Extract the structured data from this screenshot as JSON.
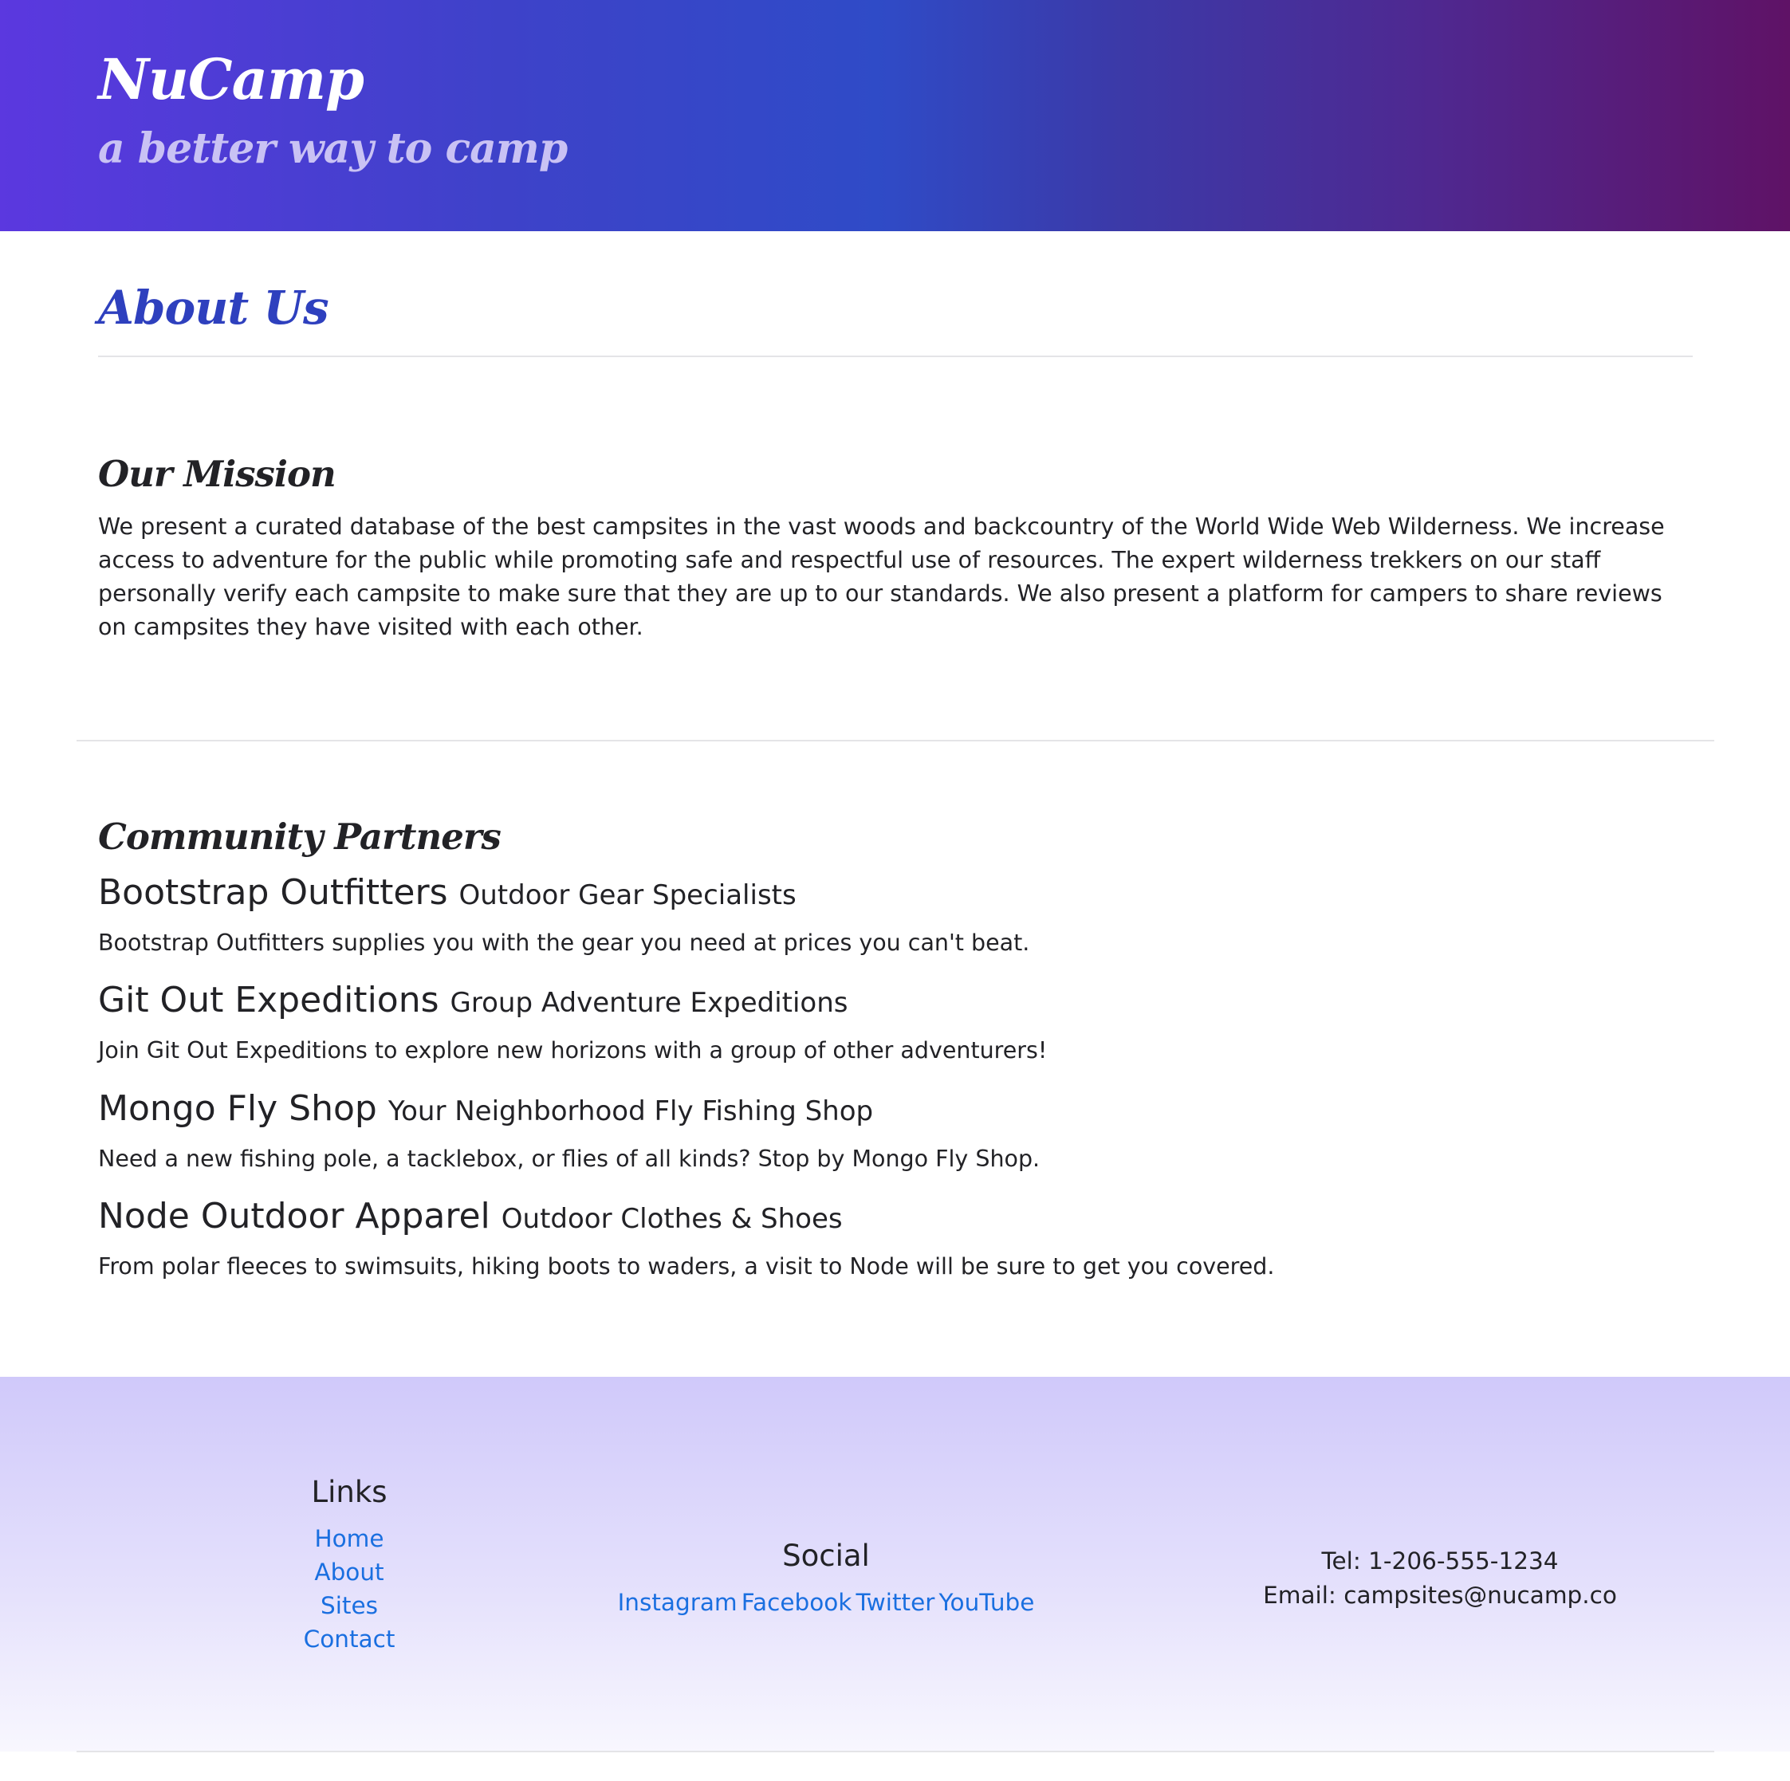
{
  "header": {
    "brand": "NuCamp",
    "tagline": "a better way to camp"
  },
  "main": {
    "title": "About Us",
    "mission": {
      "heading": "Our Mission",
      "text": "We present a curated database of the best campsites in the vast woods and backcountry of the World Wide Web Wilderness. We increase access to adventure for the public while promoting safe and respectful use of resources. The expert wilderness trekkers on our staff personally verify each campsite to make sure that they are up to our standards. We also present a platform for campers to share reviews on campsites they have visited with each other."
    },
    "partners": {
      "heading": "Community Partners",
      "items": [
        {
          "name": "Bootstrap Outfitters",
          "subtitle": "Outdoor Gear Specialists",
          "description": "Bootstrap Outfitters supplies you with the gear you need at prices you can't beat."
        },
        {
          "name": "Git Out Expeditions",
          "subtitle": "Group Adventure Expeditions",
          "description": "Join Git Out Expeditions to explore new horizons with a group of other adventurers!"
        },
        {
          "name": "Mongo Fly Shop",
          "subtitle": "Your Neighborhood Fly Fishing Shop",
          "description": "Need a new fishing pole, a tacklebox, or flies of all kinds? Stop by Mongo Fly Shop."
        },
        {
          "name": "Node Outdoor Apparel",
          "subtitle": "Outdoor Clothes & Shoes",
          "description": "From polar fleeces to swimsuits, hiking boots to waders, a visit to Node will be sure to get you covered."
        }
      ]
    }
  },
  "footer": {
    "links": {
      "heading": "Links",
      "items": [
        "Home",
        "About",
        "Sites",
        "Contact"
      ]
    },
    "social": {
      "heading": "Social",
      "items": [
        "Instagram",
        "Facebook",
        "Twitter",
        "YouTube"
      ]
    },
    "contact": {
      "tel": "Tel: 1-206-555-1234",
      "email": "Email: campsites@nucamp.co"
    }
  },
  "colors": {
    "header_gradient_start": "#5b38df",
    "header_gradient_mid": "#2f4bc7",
    "header_gradient_end": "#5f1266",
    "accent_title": "#2e40be",
    "link": "#1a6fe0",
    "footer_gradient_top": "#d0c9fa",
    "footer_gradient_bottom": "#f8f7fe"
  }
}
